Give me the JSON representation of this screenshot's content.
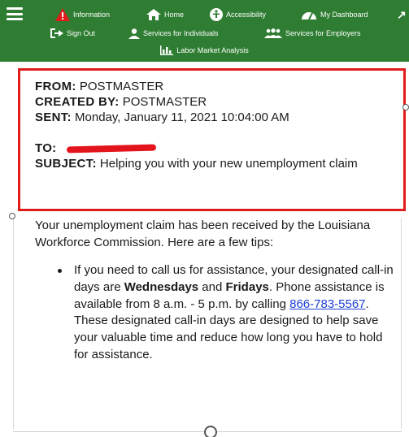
{
  "nav": {
    "row1": [
      {
        "label": "Information",
        "icon": "warning-icon"
      },
      {
        "label": "Home",
        "icon": "home-icon"
      },
      {
        "label": "Accessibility",
        "icon": "accessibility-icon"
      },
      {
        "label": "My Dashboard",
        "icon": "dashboard-icon"
      }
    ],
    "row2": [
      {
        "label": "Sign Out",
        "icon": "sign-out-icon"
      },
      {
        "label": "Services for Individuals",
        "icon": "person-icon"
      },
      {
        "label": "Services for Employers",
        "icon": "group-icon"
      }
    ],
    "row3": [
      {
        "label": "Labor Market Analysis",
        "icon": "chart-icon"
      }
    ],
    "colors": {
      "bar": "#2e7d32",
      "warning": "#e01b1b"
    }
  },
  "message": {
    "from_label": "FROM:",
    "from_value": "POSTMASTER",
    "created_label": "CREATED BY:",
    "created_value": "POSTMASTER",
    "sent_label": "SENT:",
    "sent_value": "Monday, January 11, 2021 10:04:00 AM",
    "to_label": "TO:",
    "subject_label": "SUBJECT:",
    "subject_value": "Helping you with your new unemployment claim",
    "highlight_color": "#e01b1b"
  },
  "body": {
    "intro": "Your unemployment claim has been received by the Louisiana Workforce Commission. Here are a few tips:",
    "tip1": {
      "t1": "If you need to call us for assistance, your designated call-in days are ",
      "b1": "Wednesdays",
      "t2": " and ",
      "b2": "Fridays",
      "t3": ". Phone assistance is available from 8 a.m. - 5 p.m. by calling ",
      "phone": "866-783-5567",
      "t4": ". These designated call-in days are designed to help save your valuable time and reduce how long you have to hold for assistance."
    }
  }
}
